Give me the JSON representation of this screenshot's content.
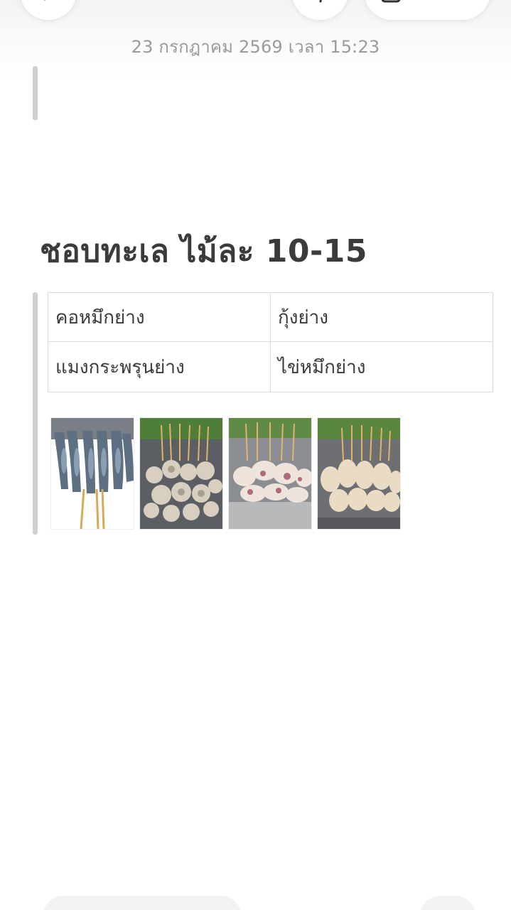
{
  "toolbar": {
    "back_icon": "chevron-left-icon",
    "undo_icon": "undo-icon",
    "share_icon": "share-icon"
  },
  "note": {
    "timestamp": "23 กรกฎาคม 2569 เวลา 15:23",
    "heading": "ชอบทะเล  ไม้ละ 10-15",
    "table": [
      [
        "คอหมึกย่าง",
        "กุ้งย่าง"
      ],
      [
        "แมงกระพรุนย่าง",
        "ไข่หมึกย่าง"
      ]
    ]
  },
  "photos": [
    {
      "icon": "grilled-shrimp-photo"
    },
    {
      "icon": "grilled-squid-neck-photo"
    },
    {
      "icon": "grilled-jellyfish-photo"
    },
    {
      "icon": "grilled-squid-egg-photo"
    }
  ],
  "colors": {
    "quote_bar": "#cfcfcf",
    "timestamp": "#9a9a9a",
    "text": "#3a3a3a"
  }
}
